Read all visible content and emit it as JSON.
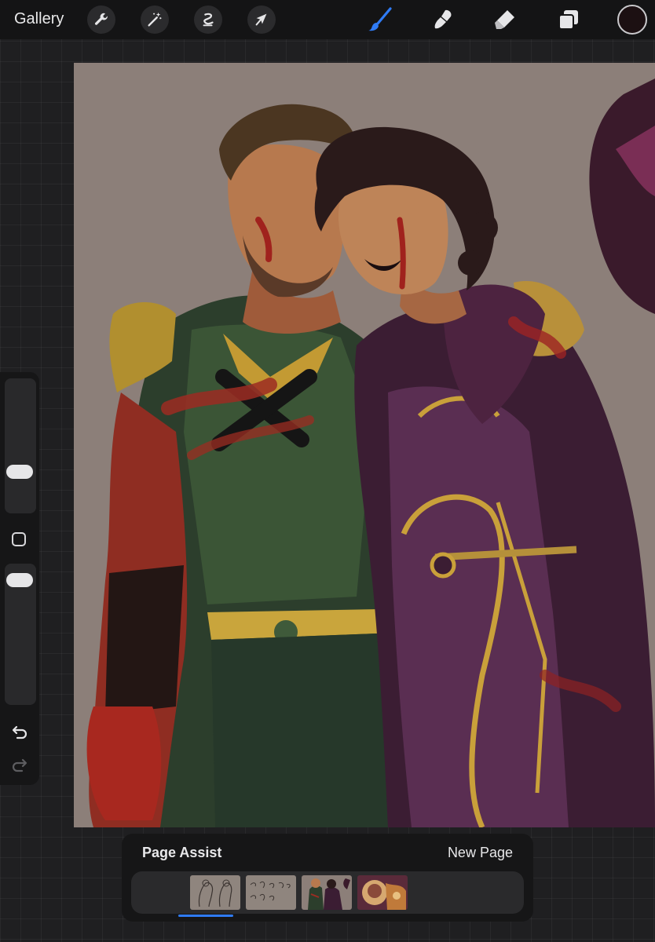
{
  "toolbar": {
    "gallery_label": "Gallery",
    "left_tools": [
      "wrench-icon",
      "magic-wand-icon",
      "selection-icon",
      "transform-arrow-icon"
    ],
    "right_tools": [
      "brush-icon",
      "smudge-icon",
      "eraser-icon",
      "layers-icon"
    ],
    "active_tool": "brush",
    "active_color": "#1c1012",
    "accent_color": "#2f7bf5"
  },
  "sidebar": {
    "brush_size_icon": "slider-thumb",
    "modify_button_icon": "square-icon",
    "undo_icon": "undo-icon",
    "redo_icon": "redo-icon"
  },
  "page_assist": {
    "title": "Page Assist",
    "new_page_label": "New Page",
    "pages_count": 4,
    "selected_page_index": 3
  }
}
